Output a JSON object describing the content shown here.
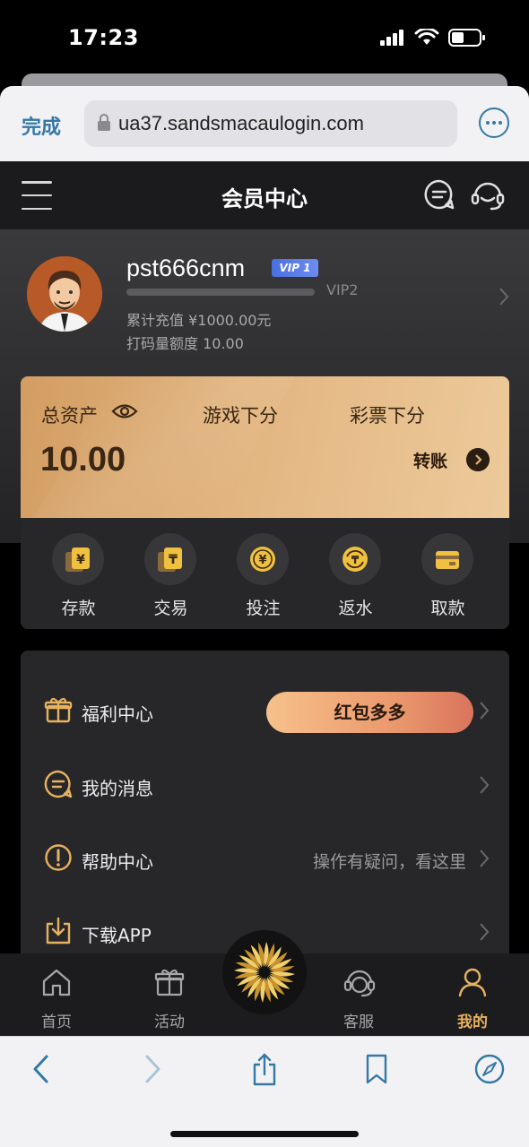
{
  "status_bar": {
    "time": "17:23"
  },
  "browser": {
    "done_label": "完成",
    "url": "ua37.sandsmacaulogin.com"
  },
  "header": {
    "title": "会员中心"
  },
  "profile": {
    "username": "pst666cnm",
    "vip_badge": "VIP 1",
    "next_vip": "VIP2",
    "vip_progress": 0.0,
    "recharge_total": "累计充值 ¥1000.00元",
    "betting_quota": "打码量额度 10.00"
  },
  "assets": {
    "total_label": "总资产",
    "game_label": "游戏下分",
    "lottery_label": "彩票下分",
    "total_value": "10.00",
    "transfer_label": "转账"
  },
  "actions": [
    {
      "label": "存款",
      "icon": "deposit-icon"
    },
    {
      "label": "交易",
      "icon": "trade-icon"
    },
    {
      "label": "投注",
      "icon": "bet-icon"
    },
    {
      "label": "返水",
      "icon": "rebate-icon"
    },
    {
      "label": "取款",
      "icon": "withdraw-icon"
    }
  ],
  "menu": {
    "welfare": {
      "label": "福利中心",
      "button": "红包多多"
    },
    "messages": {
      "label": "我的消息"
    },
    "help": {
      "label": "帮助中心",
      "hint": "操作有疑问，看这里"
    },
    "download": {
      "label": "下载APP"
    }
  },
  "bottom_nav": [
    {
      "label": "首页",
      "icon": "home-icon"
    },
    {
      "label": "活动",
      "icon": "gift-icon"
    },
    {
      "label": "客服",
      "icon": "customer-service-icon"
    },
    {
      "label": "我的",
      "icon": "user-icon",
      "active": true
    }
  ],
  "colors": {
    "gold": "#e7b25f",
    "card_gradient_start": "#d29d62",
    "card_gradient_end": "#edca9b",
    "safari_blue": "#3478a6"
  }
}
